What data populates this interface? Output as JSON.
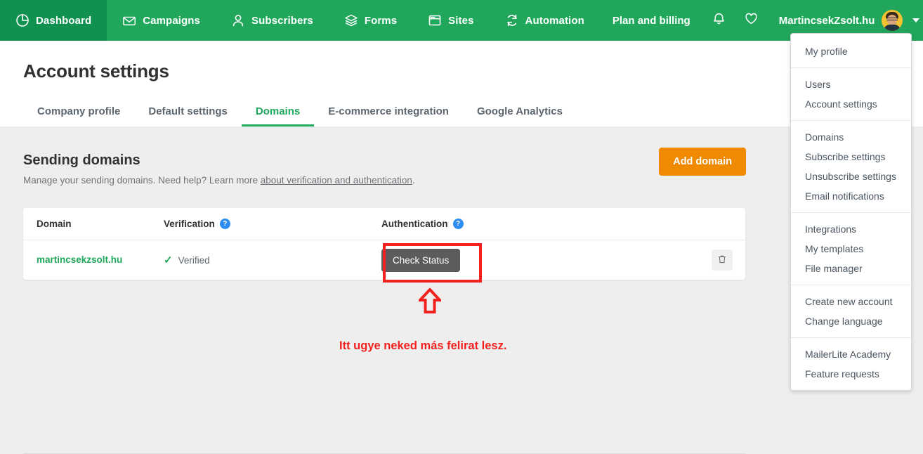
{
  "topnav": {
    "items": [
      {
        "label": "Dashboard",
        "icon": "pie-chart-icon",
        "active": true
      },
      {
        "label": "Campaigns",
        "icon": "envelope-icon",
        "active": false
      },
      {
        "label": "Subscribers",
        "icon": "person-icon",
        "active": false
      },
      {
        "label": "Forms",
        "icon": "layers-icon",
        "active": false
      },
      {
        "label": "Sites",
        "icon": "browser-icon",
        "active": false
      },
      {
        "label": "Automation",
        "icon": "refresh-icon",
        "active": false
      }
    ],
    "plan_billing": "Plan and billing",
    "bell_icon": "bell-icon",
    "heart_icon": "heart-icon",
    "account_name": "MartincsekZsolt.hu",
    "avatar": "user-avatar",
    "caret": "chevron-down-icon",
    "accent_green": "#21a75c",
    "active_green": "#119150"
  },
  "dropdown": {
    "groups": [
      {
        "items": [
          "My profile"
        ]
      },
      {
        "items": [
          "Users",
          "Account settings"
        ]
      },
      {
        "items": [
          "Domains",
          "Subscribe settings",
          "Unsubscribe settings",
          "Email notifications"
        ]
      },
      {
        "items": [
          "Integrations",
          "My templates",
          "File manager"
        ]
      },
      {
        "items": [
          "Create new account",
          "Change language"
        ]
      },
      {
        "items": [
          "MailerLite Academy",
          "Feature requests"
        ]
      }
    ]
  },
  "page": {
    "title": "Account settings",
    "tabs": [
      {
        "label": "Company profile",
        "active": false
      },
      {
        "label": "Default settings",
        "active": false
      },
      {
        "label": "Domains",
        "active": true
      },
      {
        "label": "E-commerce integration",
        "active": false
      },
      {
        "label": "Google Analytics",
        "active": false
      }
    ]
  },
  "section": {
    "title": "Sending domains",
    "desc_before": "Manage your sending domains. Need help? Learn more ",
    "desc_link": "about verification and authentication",
    "desc_after": ".",
    "add_button": "Add domain",
    "add_button_color": "#f08a00"
  },
  "table": {
    "headers": {
      "domain": "Domain",
      "verification": "Verification",
      "authentication": "Authentication",
      "help_glyph": "?"
    },
    "rows": [
      {
        "domain": "martincsekzsolt.hu",
        "verification_status": "Verified",
        "verification_glyph": "✓",
        "auth_button": "Check Status",
        "delete_icon": "trash-icon"
      }
    ]
  },
  "annotation": {
    "text": "Itt ugye neked más felirat lesz.",
    "color": "#f32020",
    "arrow_icon": "up-arrow-icon",
    "highlight_box": "red-highlight-box"
  }
}
